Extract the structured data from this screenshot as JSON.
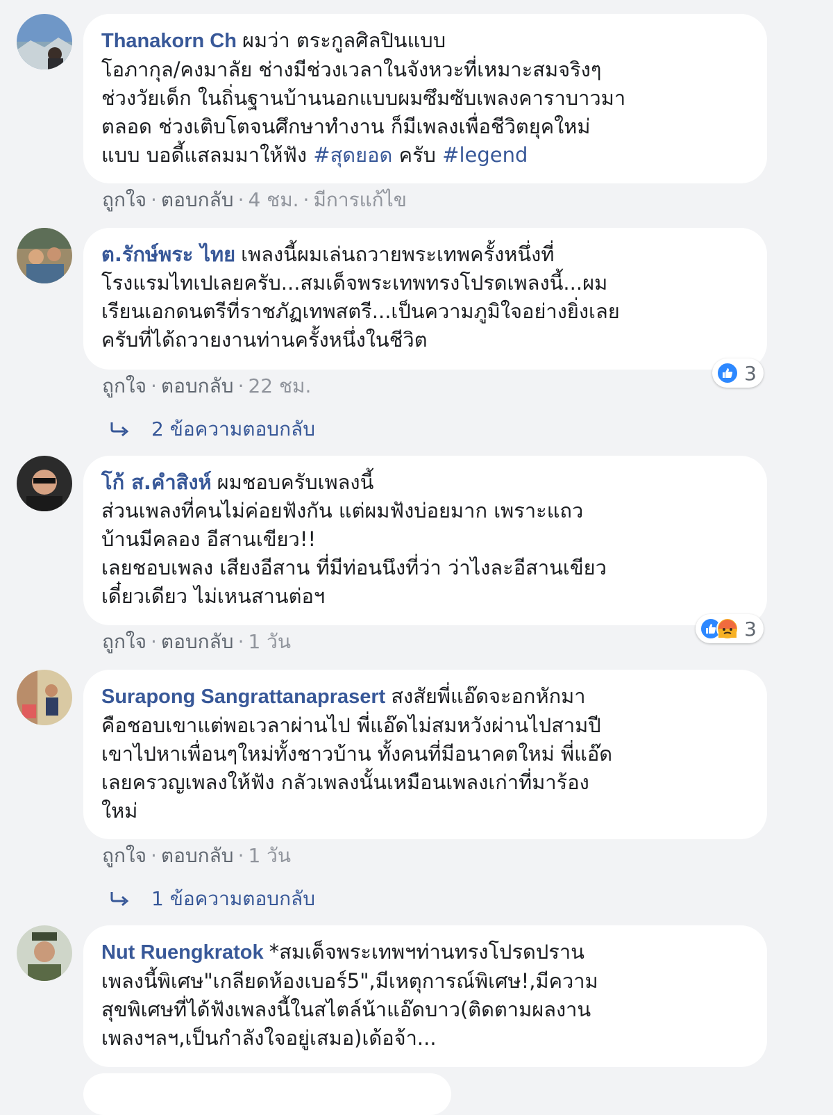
{
  "comments": [
    {
      "author": "Thanakorn Ch",
      "lines": [
        "ผมว่า ตระกูลศิลปินแบบ",
        "โอภากุล/คงมาลัย ช่างมีช่วงเวลาในจังหวะที่เหมาะสมจริงๆ",
        "ช่วงวัยเด็ก ในถิ่นฐานบ้านนอกแบบผมซึมซับเพลงคาราบาวมา",
        "ตลอด ช่วงเติบโตจนศึกษาทำงาน ก็มีเพลงเพื่อชีวิตยุคใหม่"
      ],
      "last_line_text": "แบบ บอดี้แสลมมาให้ฟัง",
      "hashtag1": "#สุดยอด",
      "last_line_mid": "ครับ",
      "hashtag2": "#legend",
      "like": "ถูกใจ",
      "reply": "ตอบกลับ",
      "time": "4 ชม.",
      "edited": "มีการแก้ไข"
    },
    {
      "author": "ต.รักษ์พระ ไทย",
      "lines": [
        "เพลงนี้ผมเล่นถวายพระเทพครั้งหนึ่งที่",
        "โรงแรมไทเปเลยครับ...สมเด็จพระเทพทรงโปรดเพลงนี้...ผม",
        "เรียนเอกดนตรีที่ราชภัฏเทพสตรี...เป็นความภูมิใจอย่างยิ่งเลย",
        "ครับที่ได้ถวายงานท่านครั้งหนึ่งในชีวิต"
      ],
      "like": "ถูกใจ",
      "reply": "ตอบกลับ",
      "time": "22 ชม.",
      "reaction_count": "3",
      "replies_label": "2 ข้อความตอบกลับ"
    },
    {
      "author": "โก้ ส.คำสิงห์",
      "lines": [
        "ผมชอบครับเพลงนี้",
        "ส่วนเพลงที่คนไม่ค่อยฟังกัน แต่ผมฟังบ่อยมาก เพราะแถว",
        "บ้านมีคลอง อีสานเขียว!!",
        "เลยชอบเพลง เสียงอีสาน ที่มีท่อนนึงที่ว่า ว่าไงละอีสานเขียว",
        "เดี๋ยวเดียว ไม่เหนสานต่อฯ"
      ],
      "like": "ถูกใจ",
      "reply": "ตอบกลับ",
      "time": "1 วัน",
      "reaction_count": "3"
    },
    {
      "author": "Surapong Sangrattanaprasert",
      "lines": [
        "สงสัยพี่แอ๊ดจะอกหักมา",
        "คือชอบเขาแต่พอเวลาผ่านไป พี่แอ๊ดไม่สมหวังผ่านไปสามปี",
        "เขาไปหาเพื่อนๆใหม่ทั้งชาวบ้าน ทั้งคนที่มีอนาคตใหม่ พี่แอ๊ด",
        "เลยครวญเพลงให้ฟัง กลัวเพลงนั้นเหมือนเพลงเก่าที่มาร้อง",
        "ใหม่"
      ],
      "like": "ถูกใจ",
      "reply": "ตอบกลับ",
      "time": "1 วัน",
      "replies_label": "1 ข้อความตอบกลับ"
    },
    {
      "author": "Nut Ruengkratok",
      "lines": [
        "*สมเด็จพระเทพฯท่านทรงโปรดปราน",
        "เพลงนี้พิเศษ\"เกลียดห้องเบอร์5\",มีเหตุการณ์พิเศษ!,มีความ",
        "สุขพิเศษที่ได้ฟังเพลงนี้ในสไตล์น้าแอ๊ดบาว(ติดตามผลงาน",
        "เพลงฯลฯ,เป็นกำลังใจอยู่เสมอ)เด้อจ้า..."
      ]
    }
  ],
  "colors": {
    "author": "#385898",
    "background": "#f2f3f5",
    "bubble": "#ffffff",
    "meta": "#90949c",
    "like_reaction": "#2d88ff",
    "angry_reaction": "#f7b125"
  }
}
